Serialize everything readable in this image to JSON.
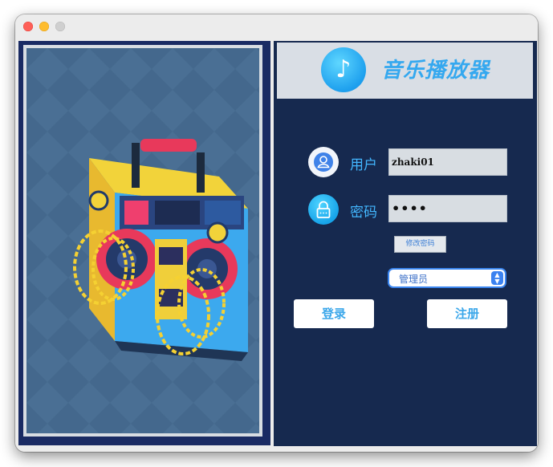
{
  "window": {
    "controls": [
      "close",
      "minimize",
      "zoom"
    ]
  },
  "header": {
    "title": "音乐播放器",
    "logo_icon": "music-note-icon",
    "logo_glyph": "♪"
  },
  "login": {
    "username_label": "用户",
    "username_value": "zhaki01",
    "password_label": "密码",
    "password_value": "••••",
    "change_password_label": "修改密码",
    "role_selected": "管理员",
    "login_label": "登录",
    "register_label": "注册"
  },
  "image": {
    "subject": "boombox-illustration"
  },
  "colors": {
    "accent": "#34a8ef",
    "panel": "#16294f",
    "frame": "#1a2b63"
  }
}
